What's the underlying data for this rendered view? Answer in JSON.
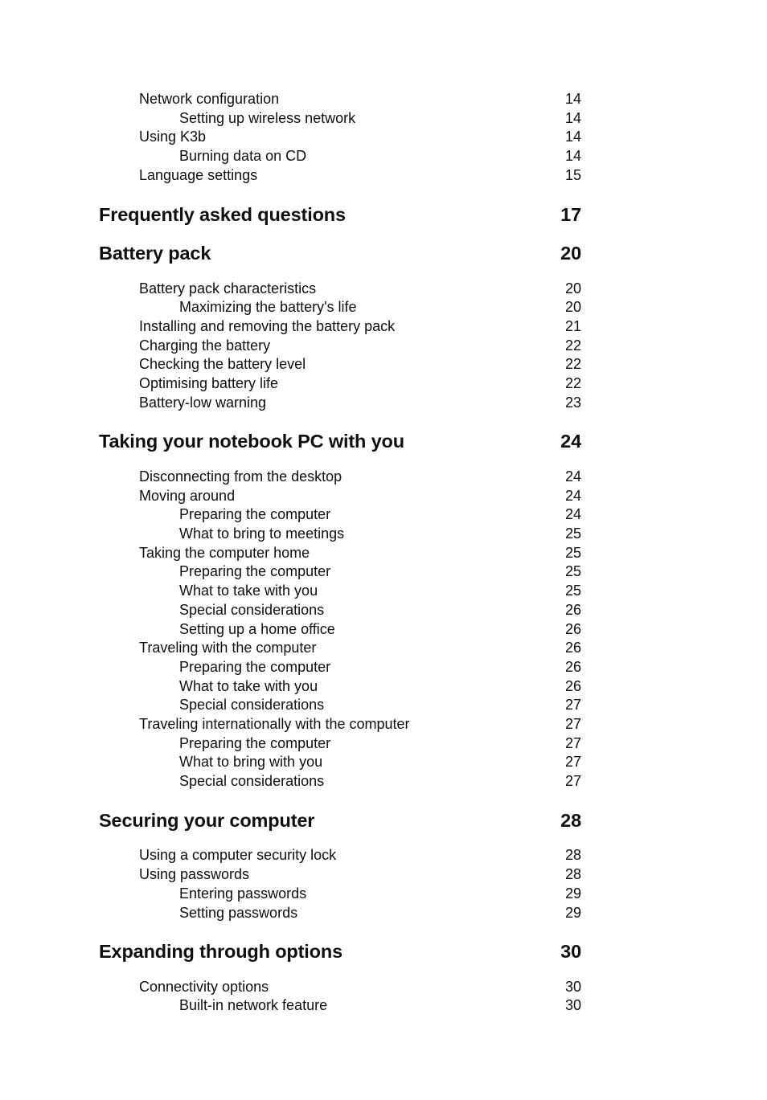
{
  "document": {
    "type": "table-of-contents",
    "page_background": "#ffffff",
    "text_color": "#100f0d"
  },
  "toc": {
    "entries": [
      {
        "level": 1,
        "title": "Network configuration",
        "page": "14"
      },
      {
        "level": 2,
        "title": "Setting up wireless network",
        "page": "14"
      },
      {
        "level": 1,
        "title": "Using K3b",
        "page": "14"
      },
      {
        "level": 2,
        "title": "Burning data on CD",
        "page": "14"
      },
      {
        "level": 1,
        "title": "Language settings",
        "page": "15"
      },
      {
        "level": 0,
        "title": "Frequently asked questions",
        "page": "17"
      },
      {
        "level": 0,
        "title": "Battery pack",
        "page": "20"
      },
      {
        "level": 1,
        "title": "Battery pack characteristics",
        "page": "20"
      },
      {
        "level": 2,
        "title": "Maximizing the battery's life",
        "page": "20"
      },
      {
        "level": 1,
        "title": "Installing and removing the battery pack",
        "page": "21"
      },
      {
        "level": 1,
        "title": "Charging the battery",
        "page": "22"
      },
      {
        "level": 1,
        "title": "Checking the battery level",
        "page": "22"
      },
      {
        "level": 1,
        "title": "Optimising battery life",
        "page": "22"
      },
      {
        "level": 1,
        "title": "Battery-low warning",
        "page": "23"
      },
      {
        "level": 0,
        "title": "Taking your notebook PC with you",
        "page": "24"
      },
      {
        "level": 1,
        "title": "Disconnecting from the desktop",
        "page": "24"
      },
      {
        "level": 1,
        "title": "Moving around",
        "page": "24"
      },
      {
        "level": 2,
        "title": "Preparing the computer",
        "page": "24"
      },
      {
        "level": 2,
        "title": "What to bring to meetings",
        "page": "25"
      },
      {
        "level": 1,
        "title": "Taking the computer home",
        "page": "25"
      },
      {
        "level": 2,
        "title": "Preparing the computer",
        "page": "25"
      },
      {
        "level": 2,
        "title": "What to take with you",
        "page": "25"
      },
      {
        "level": 2,
        "title": "Special considerations",
        "page": "26"
      },
      {
        "level": 2,
        "title": "Setting up a home office",
        "page": "26"
      },
      {
        "level": 1,
        "title": "Traveling with the computer",
        "page": "26"
      },
      {
        "level": 2,
        "title": "Preparing the computer",
        "page": "26"
      },
      {
        "level": 2,
        "title": "What to take with you",
        "page": "26"
      },
      {
        "level": 2,
        "title": "Special considerations",
        "page": "27"
      },
      {
        "level": 1,
        "title": "Traveling internationally with the computer",
        "page": "27"
      },
      {
        "level": 2,
        "title": "Preparing the computer",
        "page": "27"
      },
      {
        "level": 2,
        "title": "What to bring with you",
        "page": "27"
      },
      {
        "level": 2,
        "title": "Special considerations",
        "page": "27"
      },
      {
        "level": 0,
        "title": "Securing your computer",
        "page": "28"
      },
      {
        "level": 1,
        "title": "Using a computer security lock",
        "page": "28"
      },
      {
        "level": 1,
        "title": "Using passwords",
        "page": "28"
      },
      {
        "level": 2,
        "title": "Entering passwords",
        "page": "29"
      },
      {
        "level": 2,
        "title": "Setting passwords",
        "page": "29"
      },
      {
        "level": 0,
        "title": "Expanding through options",
        "page": "30"
      },
      {
        "level": 1,
        "title": "Connectivity options",
        "page": "30"
      },
      {
        "level": 2,
        "title": "Built-in network feature",
        "page": "30"
      }
    ]
  }
}
